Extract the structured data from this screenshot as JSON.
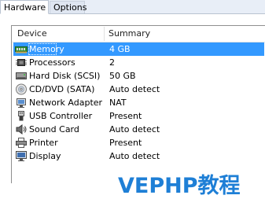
{
  "tabs": [
    {
      "label": "Hardware",
      "active": true
    },
    {
      "label": "Options",
      "active": false
    }
  ],
  "list": {
    "columns": {
      "device": "Device",
      "summary": "Summary"
    },
    "rows": [
      {
        "device": "Memory",
        "summary": "4 GB",
        "icon": "memory-icon",
        "selected": true
      },
      {
        "device": "Processors",
        "summary": "2",
        "icon": "processor-icon",
        "selected": false
      },
      {
        "device": "Hard Disk (SCSI)",
        "summary": "50 GB",
        "icon": "hard-disk-icon",
        "selected": false
      },
      {
        "device": "CD/DVD (SATA)",
        "summary": "Auto detect",
        "icon": "cd-dvd-icon",
        "selected": false
      },
      {
        "device": "Network Adapter",
        "summary": "NAT",
        "icon": "network-adapter-icon",
        "selected": false
      },
      {
        "device": "USB Controller",
        "summary": "Present",
        "icon": "usb-icon",
        "selected": false
      },
      {
        "device": "Sound Card",
        "summary": "Auto detect",
        "icon": "sound-card-icon",
        "selected": false
      },
      {
        "device": "Printer",
        "summary": "Present",
        "icon": "printer-icon",
        "selected": false
      },
      {
        "device": "Display",
        "summary": "Auto detect",
        "icon": "display-icon",
        "selected": false
      }
    ]
  },
  "watermark": "VEPHP教程",
  "colors": {
    "selection": "#3399ff",
    "watermark": "#1e7fd6"
  }
}
